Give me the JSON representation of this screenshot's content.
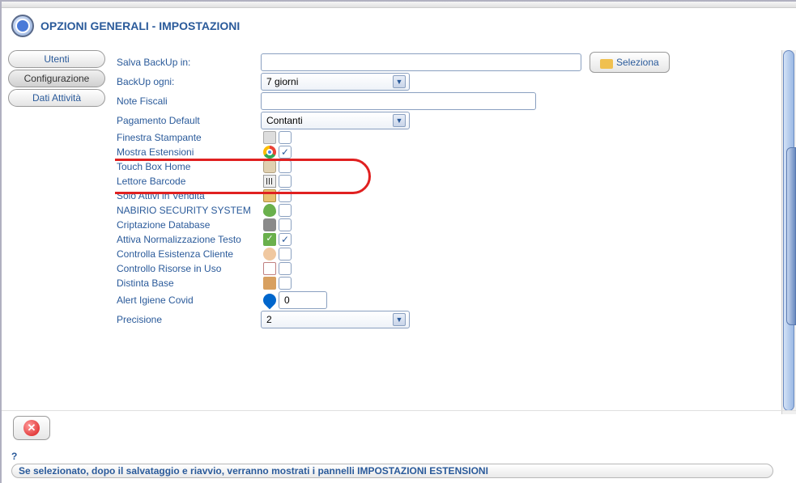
{
  "header": {
    "title": "OPZIONI GENERALI - IMPOSTAZIONI"
  },
  "sidebar": {
    "tabs": [
      {
        "label": "Utenti",
        "active": false
      },
      {
        "label": "Configurazione",
        "active": true
      },
      {
        "label": "Dati Attività",
        "active": false
      }
    ]
  },
  "form": {
    "backup_path_label": "Salva BackUp in:",
    "backup_path_value": "",
    "select_button": "Seleziona",
    "backup_every_label": "BackUp ogni:",
    "backup_every_value": "7 giorni",
    "fiscal_notes_label": "Note Fiscali",
    "fiscal_notes_value": "",
    "payment_label": "Pagamento Default",
    "payment_value": "Contanti",
    "rows": [
      {
        "label": "Finestra Stampante",
        "icon": "printer",
        "checked": false
      },
      {
        "label": "Mostra Estensioni",
        "icon": "chrome",
        "checked": true
      },
      {
        "label": "Touch Box Home",
        "icon": "touch",
        "checked": false
      },
      {
        "label": "Lettore Barcode",
        "icon": "barcode",
        "checked": false
      },
      {
        "label": "Solo Attivi in Vendita",
        "icon": "stack",
        "checked": false
      },
      {
        "label": "NABIRIO SECURITY SYSTEM",
        "icon": "shield",
        "checked": false
      },
      {
        "label": "Criptazione Database",
        "icon": "db",
        "checked": false
      },
      {
        "label": "Attiva Normalizzazione Testo",
        "icon": "check",
        "checked": true
      },
      {
        "label": "Controlla Esistenza Cliente",
        "icon": "user",
        "checked": false
      },
      {
        "label": "Controllo Risorse in Uso",
        "icon": "cal",
        "checked": false
      },
      {
        "label": "Distinta Base",
        "icon": "box",
        "checked": false
      }
    ],
    "covid_label": "Alert Igiene Covid",
    "covid_value": "0",
    "precision_label": "Precisione",
    "precision_value": "2"
  },
  "footer": {
    "help_mark": "?",
    "help_text": "Se selezionato, dopo il salvataggio e riavvio, verranno mostrati i pannelli IMPOSTAZIONI ESTENSIONI"
  }
}
